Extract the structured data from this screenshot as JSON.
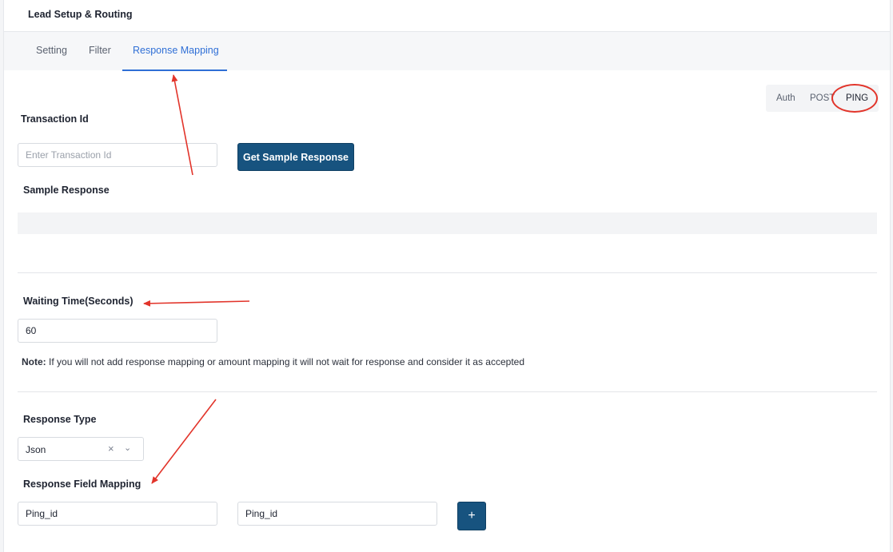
{
  "header": {
    "title": "Lead Setup & Routing"
  },
  "tabs": [
    {
      "label": "Setting",
      "active": false
    },
    {
      "label": "Filter",
      "active": false
    },
    {
      "label": "Response Mapping",
      "active": true
    }
  ],
  "segmented": {
    "items": [
      "Auth",
      "POST",
      "PING"
    ],
    "selected": "PING"
  },
  "transaction": {
    "label": "Transaction Id",
    "placeholder": "Enter Transaction Id",
    "value": "",
    "button_label": "Get Sample Response"
  },
  "sample_response": {
    "label": "Sample Response",
    "content": ""
  },
  "waiting_time": {
    "label": "Waiting Time(Seconds)",
    "value": "60"
  },
  "note": {
    "prefix": "Note:",
    "text": "If you will not add response mapping or amount mapping it will not wait for response and consider it as accepted"
  },
  "response_type": {
    "label": "Response Type",
    "selected": "Json",
    "clear_glyph": "×",
    "chevron_glyph": "⌄"
  },
  "field_mapping": {
    "label": "Response Field Mapping",
    "source_value": "Ping_id",
    "target_value": "Ping_id",
    "add_label": "+"
  },
  "annotations": {
    "color": "#e2342a",
    "highlight": "PING"
  },
  "colors": {
    "accent": "#2f6fd6",
    "primary_button": "#17537f"
  }
}
